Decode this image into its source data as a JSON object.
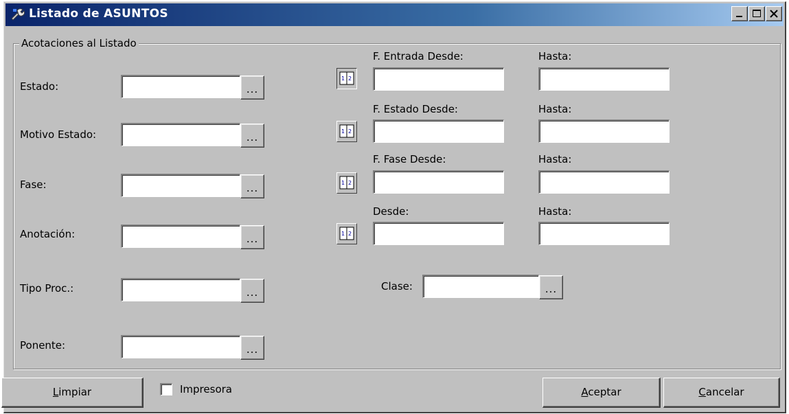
{
  "window": {
    "title": "Listado de ASUNTOS",
    "controls": {
      "minimize": "minimize",
      "maximize": "maximize",
      "close": "close"
    }
  },
  "group": {
    "label": "Acotaciones al Listado"
  },
  "left_fields": [
    {
      "label": "Estado:",
      "value": "",
      "button": "..."
    },
    {
      "label": "Motivo Estado:",
      "value": "",
      "button": "..."
    },
    {
      "label": "Fase:",
      "value": "",
      "button": "..."
    },
    {
      "label": "Anotación:",
      "value": "",
      "button": "..."
    },
    {
      "label": "Tipo Proc.:",
      "value": "",
      "button": "..."
    },
    {
      "label": "Ponente:",
      "value": "",
      "button": "..."
    }
  ],
  "date_ranges": [
    {
      "from_label": "F. Entrada Desde:",
      "to_label": "Hasta:",
      "from_value": "",
      "to_value": ""
    },
    {
      "from_label": "F. Estado Desde:",
      "to_label": "Hasta:",
      "from_value": "",
      "to_value": ""
    },
    {
      "from_label": "F. Fase Desde:",
      "to_label": "Hasta:",
      "from_value": "",
      "to_value": ""
    },
    {
      "from_label": "Desde:",
      "to_label": "Hasta:",
      "from_value": "",
      "to_value": ""
    }
  ],
  "clase": {
    "label": "Clase:",
    "value": "",
    "button": "..."
  },
  "footer": {
    "limpiar": {
      "accel": "L",
      "rest": "impiar"
    },
    "impresora": {
      "label": "Impresora",
      "checked": false
    },
    "aceptar": {
      "accel": "A",
      "rest": "ceptar"
    },
    "cancelar": {
      "accel": "C",
      "rest": "ancelar"
    }
  },
  "icons": {
    "app": "wrench-app-icon",
    "calendar": "calendar-icon"
  },
  "colors": {
    "face": "#c0c0c0",
    "title_start": "#0a246a",
    "title_end": "#a6caf0"
  }
}
